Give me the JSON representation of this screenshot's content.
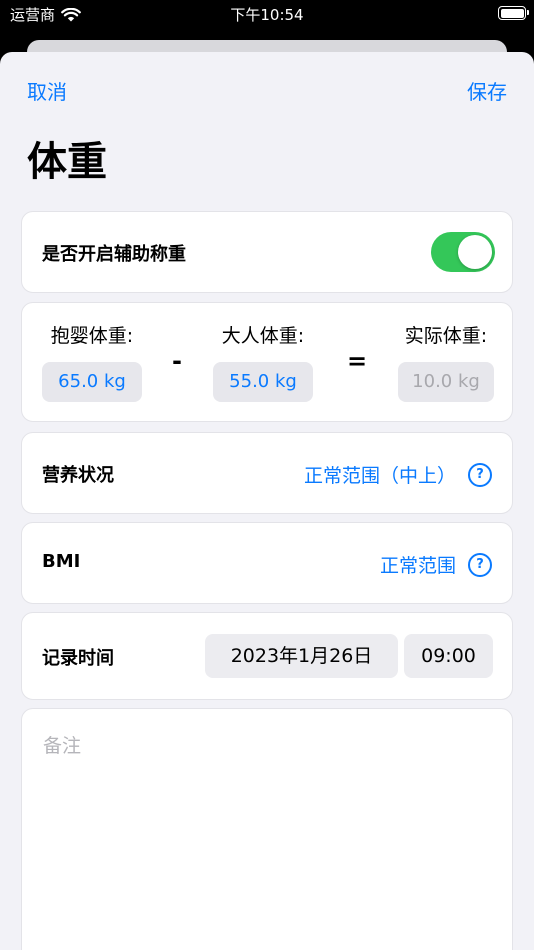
{
  "status_bar": {
    "carrier": "运营商",
    "time": "下午10:54"
  },
  "nav": {
    "cancel": "取消",
    "save": "保存"
  },
  "title": "体重",
  "assist": {
    "label": "是否开启辅助称重",
    "enabled": true,
    "toggle_color": "#34c759"
  },
  "weights": {
    "holding": {
      "label": "抱婴体重:",
      "value": "65.0 kg"
    },
    "minus": "-",
    "adult": {
      "label": "大人体重:",
      "value": "55.0 kg"
    },
    "equals": "=",
    "actual": {
      "label": "实际体重:",
      "value": "10.0 kg"
    }
  },
  "nutrition": {
    "label": "营养状况",
    "value": "正常范围（中上）"
  },
  "bmi": {
    "label": "BMI",
    "value": "正常范围"
  },
  "record": {
    "label": "记录时间",
    "date": "2023年1月26日",
    "time": "09:00"
  },
  "notes": {
    "placeholder": "备注"
  },
  "colors": {
    "accent": "#0a7aff",
    "background": "#f2f2f7"
  }
}
